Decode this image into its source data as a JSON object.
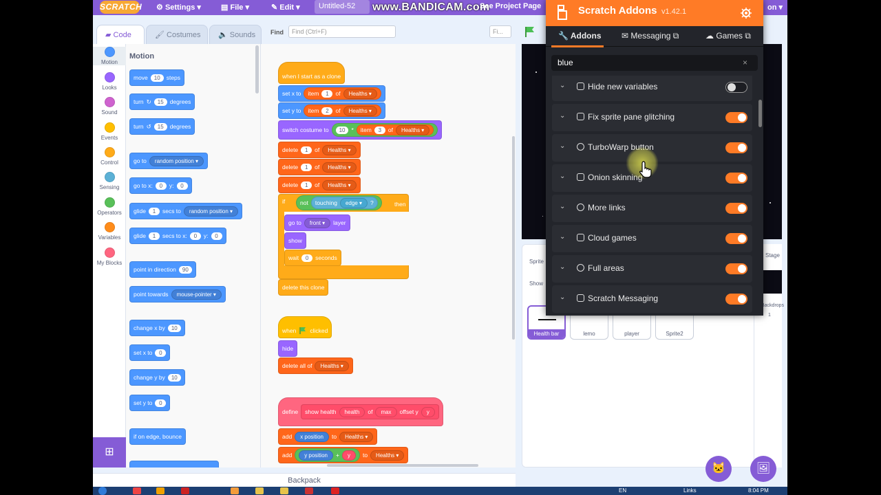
{
  "menubar": {
    "logo": "SCRATCH",
    "settings": "Settings",
    "file": "File",
    "edit": "Edit",
    "project_title": "Untitled-52",
    "see_project": "See Project Page",
    "watermark": "www.BANDICAM.com",
    "right_fragment": "on"
  },
  "tabs": {
    "code": "Code",
    "costumes": "Costumes",
    "sounds": "Sounds"
  },
  "find": {
    "label": "Find",
    "placeholder": "Find (Ctrl+F)",
    "second_placeholder": "Fi..."
  },
  "categories": [
    {
      "label": "Motion",
      "color": "#4c97ff"
    },
    {
      "label": "Looks",
      "color": "#9966ff"
    },
    {
      "label": "Sound",
      "color": "#cf63cf"
    },
    {
      "label": "Events",
      "color": "#ffbf00"
    },
    {
      "label": "Control",
      "color": "#ffab19"
    },
    {
      "label": "Sensing",
      "color": "#5cb1d6"
    },
    {
      "label": "Operators",
      "color": "#59c059"
    },
    {
      "label": "Variables",
      "color": "#ff8c1a"
    },
    {
      "label": "My Blocks",
      "color": "#ff6680"
    }
  ],
  "palette": {
    "header": "Motion",
    "move": "move",
    "move_val": "10",
    "steps": "steps",
    "turn": "turn",
    "turn_val": "15",
    "degrees": "degrees",
    "turn2_val": "15",
    "goto": "go to",
    "random_position": "random position",
    "gotoxy": "go to x:",
    "x0": "0",
    "ylbl": "y:",
    "y0": "0",
    "glide": "glide",
    "glide_val": "1",
    "secs_to": "secs to",
    "secs_to_x": "secs to x:",
    "point_direction": "point in direction",
    "dir_val": "90",
    "point_towards": "point towards",
    "mouse_pointer": "mouse-pointer",
    "change_x": "change x by",
    "cx_val": "10",
    "set_x": "set x to",
    "sx_val": "0",
    "change_y": "change y by",
    "cy_val": "10",
    "set_y": "set y to",
    "sy_val": "0",
    "bounce": "if on edge, bounce"
  },
  "script": {
    "when_clone": "when I start as a clone",
    "set_x_to": "set x to",
    "item": "item",
    "of": "of",
    "healths": "Healths",
    "n1": "1",
    "n2": "2",
    "n3": "3",
    "n10": "10",
    "mult": "*",
    "set_y_to": "set y to",
    "switch_costume": "switch costume to",
    "delete": "delete",
    "if": "if",
    "not": "not",
    "touching": "touching",
    "edge": "edge",
    "q": "?",
    "then": "then",
    "go_to": "go to",
    "front": "front",
    "layer": "layer",
    "show": "show",
    "wait": "wait",
    "wait_val": "0",
    "seconds": "seconds",
    "delete_clone": "delete this clone",
    "when": "when",
    "clicked": "clicked",
    "hide": "hide",
    "delete_all": "delete all of",
    "define": "define",
    "show_health": "show health",
    "health": "health",
    "max": "max",
    "offset_y": "offset y",
    "y": "y",
    "add": "add",
    "x_position": "x position",
    "to": "to",
    "y_position": "y position",
    "plus": "+"
  },
  "backpack": "Backpack",
  "sprites": {
    "sprite_label": "Sprite",
    "show_label": "Show",
    "stage_label": "Stage",
    "backdrops_label": "Backdrops",
    "backdrops_count": "1",
    "items": [
      "Health bar",
      "lemo",
      "player",
      "Sprite2"
    ]
  },
  "addons": {
    "title": "Scratch Addons",
    "version": "v1.42.1",
    "nav": [
      "Addons",
      "Messaging",
      "Games"
    ],
    "search": "blue",
    "clear": "×",
    "rows": [
      {
        "name": "Hide new variables",
        "enabled": false,
        "icon": "editor-icon"
      },
      {
        "name": "Fix sprite pane glitching",
        "enabled": true,
        "icon": "editor-icon"
      },
      {
        "name": "TurboWarp button",
        "enabled": true,
        "icon": "globe-icon"
      },
      {
        "name": "Onion skinning",
        "enabled": true,
        "icon": "editor-icon"
      },
      {
        "name": "More links",
        "enabled": true,
        "icon": "globe-icon"
      },
      {
        "name": "Cloud games",
        "enabled": true,
        "icon": "page-icon"
      },
      {
        "name": "Full areas",
        "enabled": true,
        "icon": "globe-icon"
      },
      {
        "name": "Scratch Messaging",
        "enabled": true,
        "icon": "page-icon"
      }
    ]
  },
  "taskbar": {
    "lang": "EN",
    "links": "Links",
    "clock": "8:04 PM"
  },
  "colors": {
    "accent": "#855cd6",
    "addons": "#ff7b26",
    "motion": "#4c97ff"
  }
}
